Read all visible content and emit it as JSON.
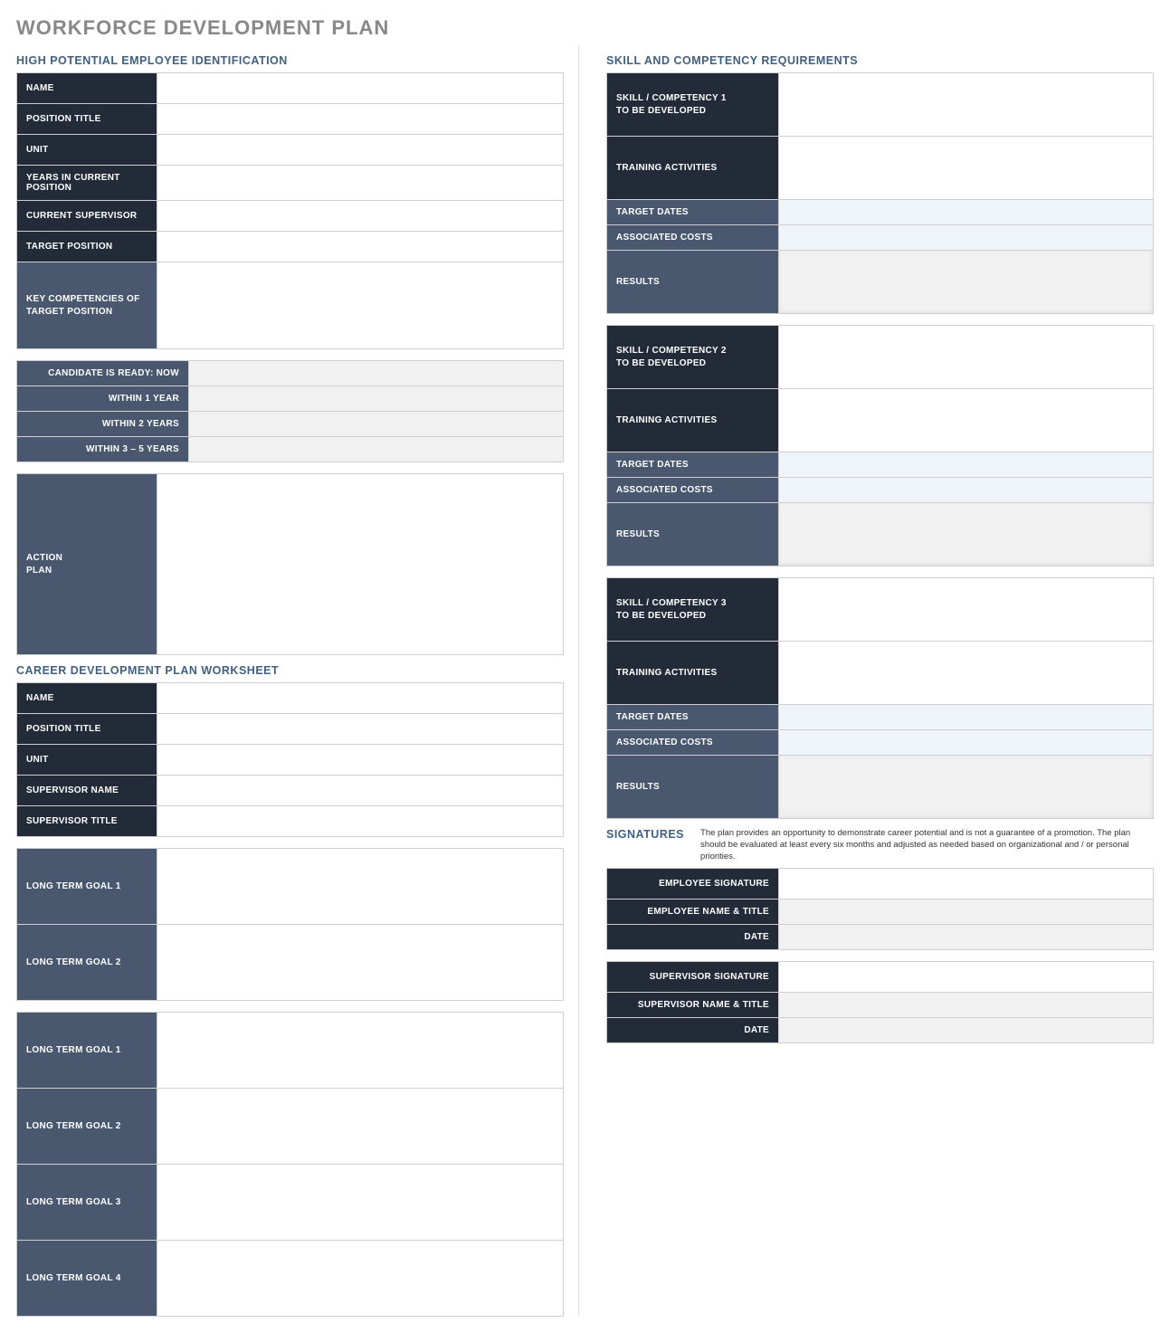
{
  "page_title": "WORKFORCE DEVELOPMENT PLAN",
  "left": {
    "section1": {
      "title": "HIGH POTENTIAL EMPLOYEE IDENTIFICATION",
      "rows": {
        "name": "NAME",
        "position_title": "POSITION TITLE",
        "unit": "UNIT",
        "years": "YEARS IN CURRENT POSITION",
        "supervisor": "CURRENT SUPERVISOR",
        "target_position": "TARGET POSITION",
        "key_comp_l1": "KEY COMPETENCIES OF",
        "key_comp_l2": "TARGET POSITION"
      },
      "ready": {
        "now": "CANDIDATE IS READY:  NOW",
        "y1": "WITHIN 1 YEAR",
        "y2": "WITHIN 2 YEARS",
        "y35": "WITHIN 3 – 5 YEARS"
      },
      "action_l1": "ACTION",
      "action_l2": "PLAN"
    },
    "section2": {
      "title": "CAREER DEVELOPMENT PLAN WORKSHEET",
      "rows": {
        "name": "NAME",
        "position_title": "POSITION TITLE",
        "unit": "UNIT",
        "supervisor_name": "SUPERVISOR NAME",
        "supervisor_title": "SUPERVISOR TITLE"
      },
      "goals_a": [
        "LONG TERM GOAL 1",
        "LONG TERM GOAL 2"
      ],
      "goals_b": [
        "LONG TERM GOAL 1",
        "LONG TERM GOAL 2",
        "LONG TERM GOAL 3",
        "LONG TERM GOAL 4"
      ]
    }
  },
  "right": {
    "section_title": "SKILL AND COMPETENCY REQUIREMENTS",
    "blocks": [
      {
        "skill_l1": "SKILL / COMPETENCY 1",
        "skill_l2": "TO BE DEVELOPED",
        "training": "TRAINING ACTIVITIES",
        "dates": "TARGET DATES",
        "costs": "ASSOCIATED COSTS",
        "results": "RESULTS"
      },
      {
        "skill_l1": "SKILL / COMPETENCY 2",
        "skill_l2": "TO BE DEVELOPED",
        "training": "TRAINING ACTIVITIES",
        "dates": "TARGET DATES",
        "costs": "ASSOCIATED COSTS",
        "results": "RESULTS"
      },
      {
        "skill_l1": "SKILL / COMPETENCY 3",
        "skill_l2": "TO BE DEVELOPED",
        "training": "TRAINING ACTIVITIES",
        "dates": "TARGET DATES",
        "costs": "ASSOCIATED COSTS",
        "results": "RESULTS"
      }
    ],
    "sig": {
      "title": "SIGNATURES",
      "note": "The plan provides an opportunity to demonstrate career potential and is not a guarantee of a promotion. The plan should be evaluated at least every six months and adjusted as needed based on organizational and / or personal priorities.",
      "emp": {
        "sig": "EMPLOYEE SIGNATURE",
        "name": "EMPLOYEE NAME & TITLE",
        "date": "DATE"
      },
      "sup": {
        "sig": "SUPERVISOR SIGNATURE",
        "name": "SUPERVISOR NAME & TITLE",
        "date": "DATE"
      }
    }
  }
}
